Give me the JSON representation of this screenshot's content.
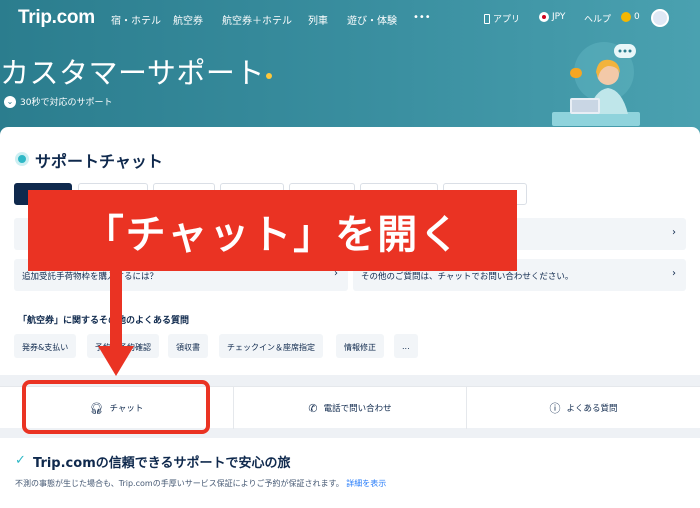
{
  "nav": {
    "logo": "Trip.com",
    "items": [
      "宿・ホテル",
      "航空券",
      "航空券＋ホテル",
      "列車",
      "遊び・体験",
      "•••"
    ],
    "app": "アプリ",
    "currency": "JPY",
    "help": "ヘルプ",
    "coins": "0"
  },
  "hero": {
    "title": "カスタマーサポート",
    "subtitle": "30秒で対応のサポート"
  },
  "support": {
    "title": "サポートチャット",
    "tabs": [
      "",
      "",
      "",
      "",
      "",
      "",
      ""
    ],
    "faqs": [
      {
        "text": "",
        "partial": "?"
      },
      {
        "text": "追加受託手荷物枠を購入するには？"
      },
      {
        "text": "その他のご質問は、チャットでお問い合わせください。"
      }
    ],
    "related_title": "「航空券」に関するその他のよくある質問",
    "chips": [
      "発券&支払い",
      "予約・予約確認",
      "領収書",
      "チェックイン＆座席指定",
      "情報修正",
      "..."
    ]
  },
  "actions": {
    "chat": "チャット",
    "phone": "電話で問い合わせ",
    "faq": "よくある質問"
  },
  "trust": {
    "title": "Trip.comの信頼できるサポートで安心の旅",
    "desc": "不測の事態が生じた場合も、Trip.comの手厚いサービス保証によりご予約が保証されます。",
    "link": "詳細を表示"
  },
  "annotation": {
    "banner": "「チャット」を開く"
  },
  "colors": {
    "brand_teal": "#2b7d8e",
    "navy": "#0f294d",
    "annotation_red": "#ea3323",
    "link_blue": "#287dfa"
  }
}
